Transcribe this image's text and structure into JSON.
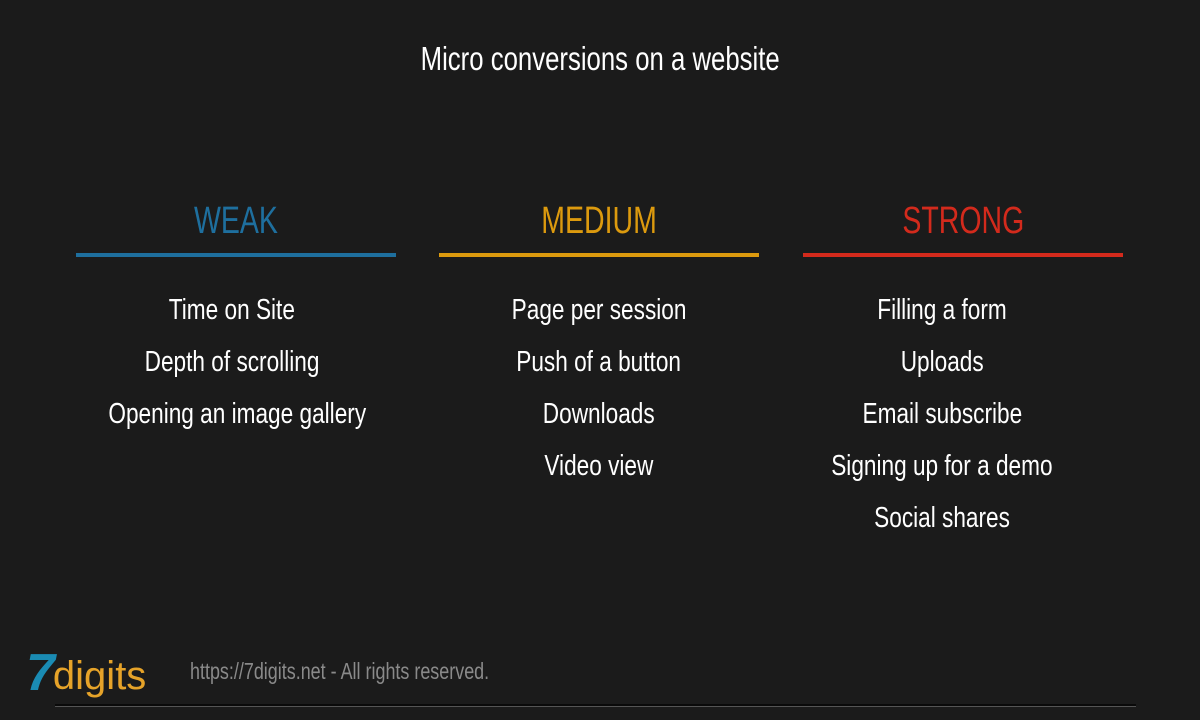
{
  "title": "Micro conversions on a website",
  "columns": [
    {
      "heading": "WEAK",
      "color": "#1e6f9e",
      "items": [
        "Time on Site",
        "Depth of scrolling",
        "Opening an image gallery"
      ]
    },
    {
      "heading": "MEDIUM",
      "color": "#dc9a0e",
      "items": [
        "Page per session",
        "Push of a button",
        "Downloads",
        "Video view"
      ]
    },
    {
      "heading": "STRONG",
      "color": "#d32a1c",
      "items": [
        "Filling a form",
        "Uploads",
        "Email subscribe",
        "Signing up for a demo",
        "Social shares"
      ]
    }
  ],
  "footer": {
    "logo_number": "7",
    "logo_word": "digits",
    "text": "https://7digits.net - All rights reserved."
  }
}
